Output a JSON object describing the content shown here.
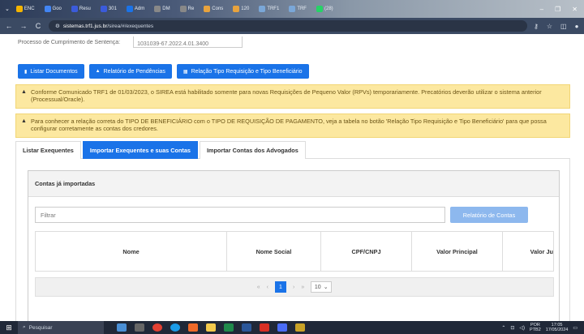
{
  "browser": {
    "tabs": [
      {
        "label": "ENC",
        "color": "#f4b400"
      },
      {
        "label": "Goo",
        "color": "#4285f4"
      },
      {
        "label": "Resu",
        "color": "#3b5bdb"
      },
      {
        "label": "301",
        "color": "#3b5bdb"
      },
      {
        "label": "Adm",
        "color": "#1a73e8"
      },
      {
        "label": "DM",
        "color": "#888888"
      },
      {
        "label": "Re",
        "color": "#888888"
      },
      {
        "label": "Cons",
        "color": "#e8a33d"
      },
      {
        "label": "120",
        "color": "#e8a33d"
      },
      {
        "label": "TRF1",
        "color": "#7aa7d8"
      },
      {
        "label": "TRF",
        "color": "#7aa7d8"
      },
      {
        "label": "(28)",
        "color": "#25d366"
      }
    ],
    "url_host": "sistemas.trf1.jus.br",
    "url_path": "/sirea/#/exequentes",
    "back": "←",
    "forward": "→",
    "reload": "C"
  },
  "page": {
    "cutoff_text": "Processo de Cumprimento de Sentença:",
    "cutoff_value": "1031039-67.2022.4.01.3400",
    "buttons": {
      "listar": "Listar Documentos",
      "relatorio": "Relatório de Pendências",
      "relacao": "Relação Tipo Requisição e Tipo Beneficiário"
    },
    "alerts": [
      "Conforme Comunicado TRF1 de 01/03/2023, o SIREA está habilitado somente para novas Requisições de Pequeno Valor (RPVs) temporariamente. Precatórios deverão utilizar o sistema anterior (Processual/Oracle).",
      "Para conhecer a relação correta do TIPO DE BENEFICIÁRIO com o TIPO DE REQUISIÇÃO DE PAGAMENTO, veja a tabela no botão 'Relação Tipo Requisição e Tipo Beneficiário' para que possa configurar corretamente as contas dos credores."
    ],
    "tabs": [
      {
        "label": "Listar Exequentes",
        "active": false
      },
      {
        "label": "Importar Exequentes e suas Contas",
        "active": true
      },
      {
        "label": "Importar Contas dos Advogados",
        "active": false
      }
    ],
    "card_title": "Contas já importadas",
    "filter_placeholder": "Filtrar",
    "report_button": "Relatório de Contas",
    "columns": [
      "Nome",
      "Nome Social",
      "CPF/CNPJ",
      "Valor Principal",
      "Valor Ju"
    ],
    "pager": {
      "first": "«",
      "prev": "‹",
      "current": "1",
      "next": "›",
      "last": "»",
      "page_size": "10"
    }
  },
  "taskbar": {
    "search_placeholder": "Pesquisar",
    "lang_top": "POR",
    "lang_bottom": "PTB2",
    "time": "17:05",
    "date": "17/05/2024"
  }
}
